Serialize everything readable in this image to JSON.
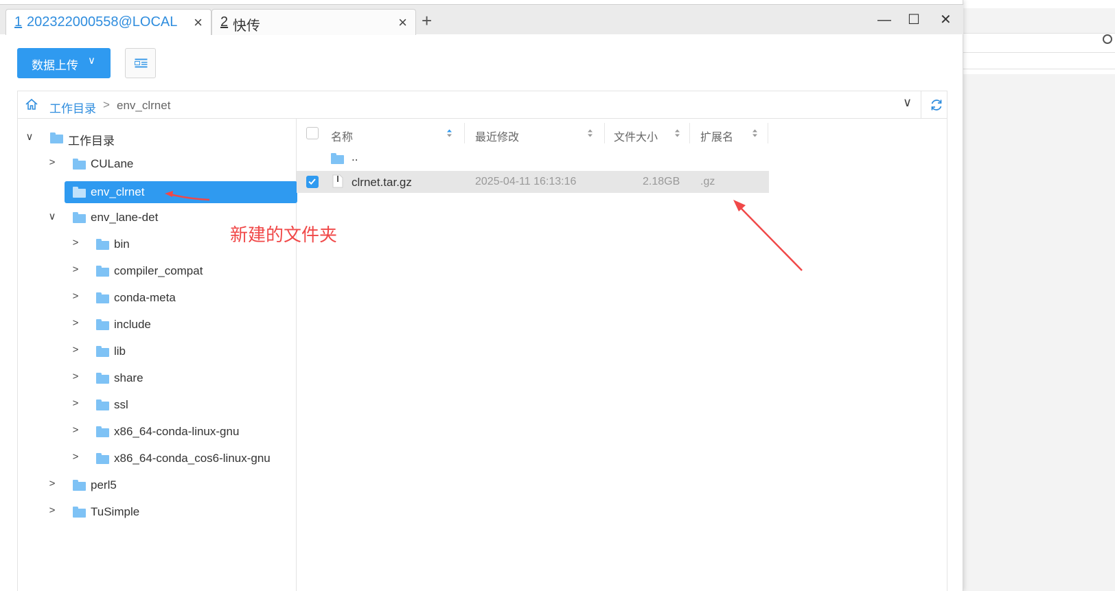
{
  "tabs": [
    {
      "num": "1",
      "title": "202322000558@LOCAL",
      "active": true
    },
    {
      "num": "2",
      "title": "快传",
      "active": false
    }
  ],
  "window_controls": {
    "minimize": "—",
    "maximize": "☐",
    "close": "✕"
  },
  "toolbar": {
    "upload_label": "数据上传",
    "upload_chevron": "∨"
  },
  "path": {
    "root": "工作目录",
    "separator": ">",
    "current": "env_clrnet"
  },
  "tree": [
    {
      "label": "工作目录",
      "arrow": "∨",
      "level": 0
    },
    {
      "label": "CULane",
      "arrow": ">",
      "level": 1
    },
    {
      "label": "env_clrnet",
      "arrow": "",
      "level": 1,
      "selected": true
    },
    {
      "label": "env_lane-det",
      "arrow": "∨",
      "level": 1
    },
    {
      "label": "bin",
      "arrow": ">",
      "level": 2
    },
    {
      "label": "compiler_compat",
      "arrow": ">",
      "level": 2
    },
    {
      "label": "conda-meta",
      "arrow": ">",
      "level": 2
    },
    {
      "label": "include",
      "arrow": ">",
      "level": 2
    },
    {
      "label": "lib",
      "arrow": ">",
      "level": 2
    },
    {
      "label": "share",
      "arrow": ">",
      "level": 2
    },
    {
      "label": "ssl",
      "arrow": ">",
      "level": 2
    },
    {
      "label": "x86_64-conda-linux-gnu",
      "arrow": ">",
      "level": 2
    },
    {
      "label": "x86_64-conda_cos6-linux-gnu",
      "arrow": ">",
      "level": 2
    },
    {
      "label": "perl5",
      "arrow": ">",
      "level": 1
    },
    {
      "label": "TuSimple",
      "arrow": ">",
      "level": 1
    }
  ],
  "columns": {
    "name": "名称",
    "modified": "最近修改",
    "size": "文件大小",
    "ext": "扩展名"
  },
  "files": {
    "parent": {
      "name": ".."
    },
    "items": [
      {
        "name": "clrnet.tar.gz",
        "modified": "2025-04-11 16:13:16",
        "size": "2.18GB",
        "ext": ".gz",
        "checked": true
      }
    ]
  },
  "annotation": {
    "text": "新建的文件夹",
    "color": "#f04848"
  },
  "colors": {
    "accent": "#2f9af0",
    "link": "#2f8dde",
    "folder": "#7ec2f5"
  }
}
